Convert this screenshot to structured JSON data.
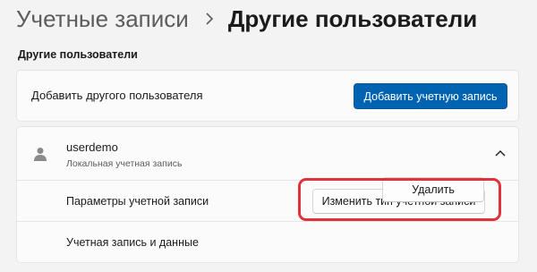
{
  "breadcrumb": {
    "parent": "Учетные записи",
    "current": "Другие пользователи",
    "separator_icon": "chevron-right-icon"
  },
  "section": {
    "title": "Другие пользователи"
  },
  "add_user": {
    "label": "Добавить другого пользователя",
    "button_label": "Добавить учетную запись"
  },
  "user": {
    "name": "userdemo",
    "account_type": "Локальная учетная запись",
    "avatar_icon": "person-icon",
    "expand_icon": "chevron-up-icon",
    "settings": {
      "label": "Параметры учетной записи",
      "button_label": "Изменить тип учетной записи"
    },
    "data": {
      "label": "Учетная запись и данные",
      "button_label": "Удалить"
    }
  },
  "colors": {
    "background": "#f3f3f3",
    "card": "#fbfbfb",
    "accent": "#0063b1",
    "highlight": "#e0323b"
  }
}
